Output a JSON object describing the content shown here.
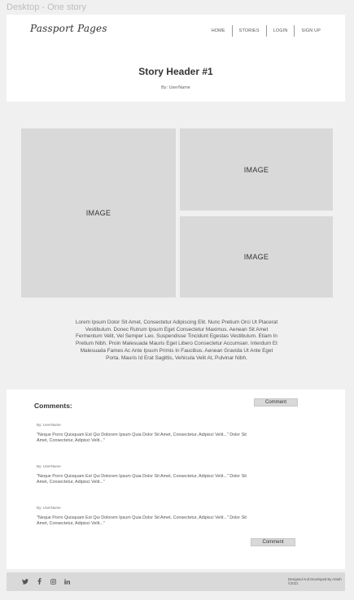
{
  "frame": {
    "label": "Desktop - One story"
  },
  "header": {
    "logo": "Passport Pages",
    "nav": [
      {
        "label": "HOME"
      },
      {
        "label": "STORIES"
      },
      {
        "label": "LOGIN"
      },
      {
        "label": "SIGN UP"
      }
    ]
  },
  "story": {
    "title": "Story Header #1",
    "byline": "By: UserName",
    "images": [
      "IMAGE",
      "IMAGE",
      "IMAGE"
    ],
    "body": "Lorem Ipsum Dolor Sit Amet, Consectetur Adipiscing Elit. Nunc Pretium Orci Ut Placerat Vestibulum. Donec Rutrum Ipsum Eget Consectetur Maximus. Aenean Sit Amet Fermentum Velit, Vel Semper Leo. Suspendisse Tincidunt Egestas Vestibulum. Etiam In Pretium Nibh. Proin Malesuada Mauris Eget Libero Consectetur Accumsan. Interdum Et Malesuada Fames Ac Ante Ipsum Primis In Faucibus. Aenean Gravida Ut Ante Eget Porta. Mauris Id Erat Sagittis, Vehicula Velit At, Pulvinar Nibh."
  },
  "comments": {
    "heading": "Comments:",
    "button_top": "Comment",
    "button_bottom": "Comment",
    "items": [
      {
        "by": "By: UserName",
        "text": "\"Neque Porro Quisquam Est Qui Dolorem Ipsum Quia Dolor Sit Amet, Consectetur, Adipisci Velit...\" Dolor Sit Amet, Consectetur, Adipisci Velit...\""
      },
      {
        "by": "By: UserName",
        "text": "\"Neque Porro Quisquam Est Qui Dolorem Ipsum Quia Dolor Sit Amet, Consectetur, Adipisci Velit...\" Dolor Sit Amet, Consectetur, Adipisci Velit...\""
      },
      {
        "by": "By: UserName",
        "text": "\"Neque Porro Quisquam Est Qui Dolorem Ipsum Quia Dolor Sit Amet, Consectetur, Adipisci Velit...\" Dolor Sit Amet, Consectetur, Adipisci Velit...\""
      }
    ]
  },
  "footer": {
    "social_icons": [
      "twitter-icon",
      "facebook-icon",
      "instagram-icon",
      "linkedin-icon"
    ],
    "credit": "Designed And Developed By AtSah ©2021"
  },
  "colors": {
    "background": "#f0f0f0",
    "card": "#ffffff",
    "placeholder": "#d9d9d9"
  }
}
